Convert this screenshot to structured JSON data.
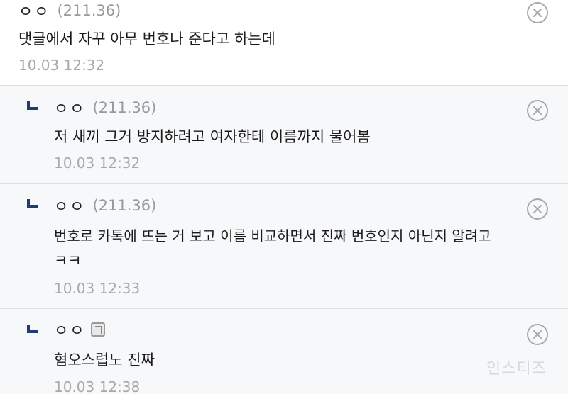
{
  "comments": [
    {
      "author": "ㅇㅇ",
      "ip": "(211.36)",
      "text": "댓글에서 자꾸 아무 번호나 준다고 하는데",
      "time": "10.03 12:32",
      "is_reply": false
    },
    {
      "author": "ㅇㅇ",
      "ip": "(211.36)",
      "text": "저 새끼 그거 방지하려고 여자한테 이름까지 물어봄",
      "time": "10.03 12:32",
      "is_reply": true
    },
    {
      "author": "ㅇㅇ",
      "ip": "(211.36)",
      "text_line1": "번호로 카톡에 뜨는 거 보고 이름 비교하면서 진짜 번호인지 아닌지 알려고",
      "text_line2": "ㅋㅋ",
      "time": "10.03 12:33",
      "is_reply": true
    },
    {
      "author": "ㅇㅇ",
      "ip": "",
      "text": "혐오스럽노 진짜",
      "time": "10.03 12:38",
      "is_reply": true
    }
  ],
  "watermark": "인스티즈",
  "icons": {
    "delete": "close-circle-icon",
    "reply": "reply-arrow-icon",
    "member_badge": "gallery-member-badge-icon"
  },
  "colors": {
    "reply_background": "#f7f8fa",
    "muted_text": "#9a9a9a",
    "divider": "#dedede"
  }
}
